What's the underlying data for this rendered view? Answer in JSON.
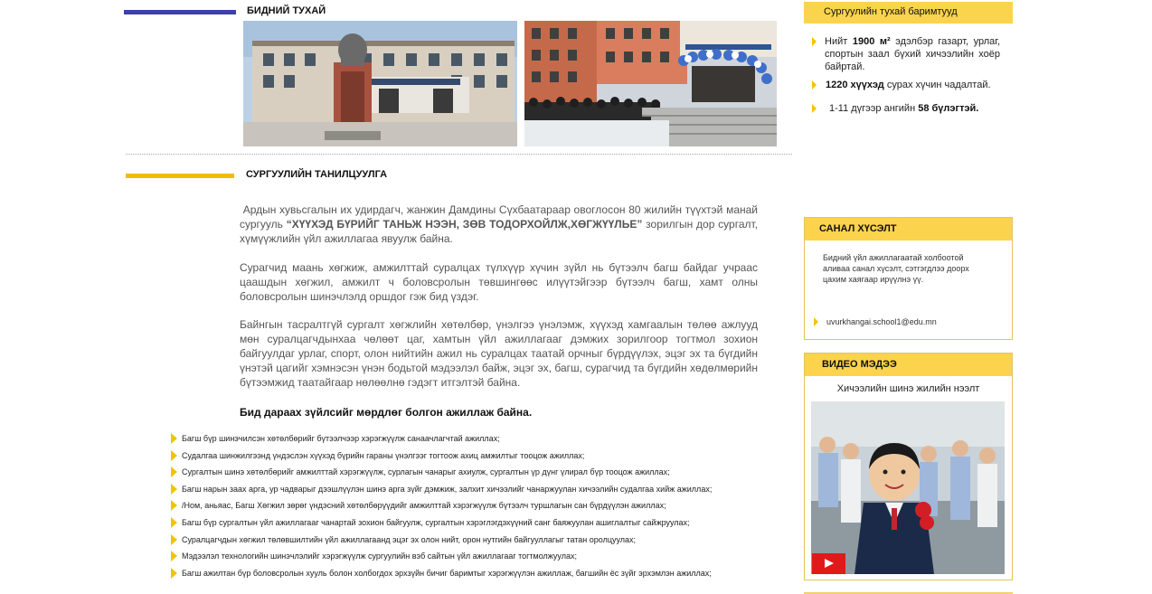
{
  "about": {
    "title": "БИДНИЙ ТУХАЙ",
    "photo1_alt": "school building with statue",
    "photo2_alt": "school entrance with balloons"
  },
  "intro": {
    "title": "СУРГУУЛИЙН ТАНИЛЦУУЛГА",
    "p1_a": "Ардын хувьсгалын их удирдагч, жанжин Дамдины Сүхбаатараар овоглосон 80 жилийн түүхтэй манай сургууль",
    "p1_b": "“ХҮҮХЭД БҮРИЙГ ТАНЬЖ НЭЭН, ЗӨВ ТОДОРХОЙЛЖ,ХӨГЖҮҮЛЬЕ”",
    "p1_c": "зорилгын дор сургалт, хүмүүжлийн үйл ажиллагаа явуулж байна.",
    "p2": "Сурагчид маань хөгжиж, амжилттай суралцах түлхүүр хүчин зүйл нь бүтээлч багш байдаг учраас цаашдын хөгжил, амжилт ч боловсролын төвшингөөс илүүтэйгээр бүтээлч багш, хамт олны боловсролын шинэчлэлд оршдог гэж бид үздэг.",
    "p3": "Байнгын тасралтгүй сургалт хөгжлийн хөтөлбөр, үнэлгээ үнэлэмж, хүүхэд хамгаалын төлөө ажлууд мөн суралцагчдынхаа чөлөөт цаг, хамтын үйл ажиллагааг дэмжих зорилгоор тогтмол зохион байгуулдаг урлаг, спорт, олон нийтийн ажил нь суралцах таатай орчныг бүрдүүлэх, эцэг эх та бүгдийн үнэтэй цагийг хэмнэсэн үнэн бодьтой мэдээлэл байж, эцэг эх, багш, сурагчид та бүгдийн хөдөлмөрийн бүтээмжид таатайгаар нөлөөлнө гэдэгт итгэлтэй байна.",
    "commit": "Бид дараах зүйлсийг мөрдлөг болгон ажиллаж байна."
  },
  "commitments": [
    "Багш бүр шинэчилсэн хөтөлбөрийг бүтээлчээр хэрэгжүүлж санаачлагчтай ажиллах;",
    "Судалгаа шинжилгээнд үндэслэн хүүхэд бүрийн гараны үнэлгээг тогтоож ахиц амжилтыг тооцож ажиллах;",
    "Сургалтын шинэ хөтөлбөрийг амжилттай хэрэгжүүлж, сурлагын чанарыг ахиулж, сургалтын үр дүнг үлирал бүр тооцож ажиллах;",
    "Багш нарын заах арга, ур чадварыг дээшлүүлэн шинэ арга зүйг дэмжиж, залхит хичээлийг чанаржуулан хичээлийн судалгаа хийж ажиллах;",
    "/Ном, аньяас, Багш Хөгжил зөрөг үндэсний хөтөлбөрүүдийг амжилттай хэрэгжүүлж бүтээлч туршлагын сан бүрдүүлэн ажиллах;",
    "Багш бүр сургалтын үйл ажиллагааг чанартай зохион байгуулж, сургалтын хэрэглэгдэхүүний санг баяжуулан ашиглалтыг сайжруулах;",
    "Суралцагчдын хөгжил төлөвшилтийн үйл ажиллагаанд эцэг эх олон нийт, орон нутгийн байгууллагыг татан оролцуулах;",
    "Мэдээлэл технологийн шинэчлэлийг хэрэгжүүлж сургуулийн вэб сайтын үйл ажиллагааг тогтмолжуулах;",
    "Багш ажилтан бүр боловсролын хууль болон холбогдох эрхзүйн бичиг баримтыг хэрэгжүүлэн ажиллаж, багшийн ёс зүйг эрхэмлэн ажиллах;"
  ],
  "facts": {
    "title": "Сургуулийн тухай баримтууд",
    "f1_pre": "Нийт",
    "f1_bold": "1900 м²",
    "f1_post": "эдэлбэр газарт, урлаг, спортын заал бүхий хичээлийн хоёр байртай.",
    "f2_bold": "1220 хүүхэд",
    "f2_post": "сурах хүчин чадалтай.",
    "f3_pre": "1-11 дүгээр ангийн",
    "f3_bold": "58 бүлэгтэй."
  },
  "feedback": {
    "title": "САНАЛ ХҮСЭЛТ",
    "text": "Бидний үйл ажиллагаатай холбоотой аливаа санал хүсэлт, сэтгэгдлээ доорх цахим хаягаар ирүүлнэ үү.",
    "email": "uvurkhangai.school1@edu.mn"
  },
  "video": {
    "title": "ВИДЕО МЭДЭЭ",
    "caption": "Хичээлийн шинэ жилийн нээлт"
  },
  "colors": {
    "accent_yellow": "#fcd34d",
    "bar_blue": "#3b3fb0",
    "bar_yellow": "#f1bd00",
    "play_red": "#e01a1a"
  }
}
